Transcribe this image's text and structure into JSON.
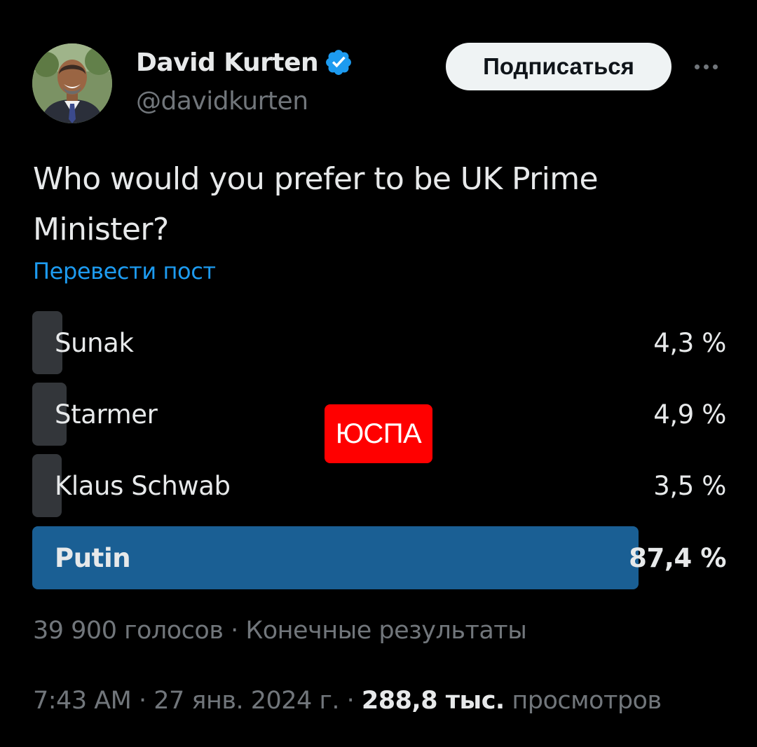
{
  "author": {
    "name": "David Kurten",
    "handle": "@davidkurten",
    "verified_color": "#1d9bf0"
  },
  "follow_button": {
    "label": "Подписаться"
  },
  "more_menu": {
    "icon": "more-horizontal-icon"
  },
  "post": {
    "text": "Who would you prefer to be UK Prime Minister?",
    "translate_label": "Перевести пост"
  },
  "poll": {
    "options": [
      {
        "label": "Sunak",
        "percent_text": "4,3 %",
        "percent": 4.3,
        "winner": false
      },
      {
        "label": "Starmer",
        "percent_text": "4,9 %",
        "percent": 4.9,
        "winner": false
      },
      {
        "label": "Klaus Schwab",
        "percent_text": "3,5 %",
        "percent": 3.5,
        "winner": false
      },
      {
        "label": "Putin",
        "percent_text": "87,4 %",
        "percent": 87.4,
        "winner": true
      }
    ],
    "votes": "39 900 голосов",
    "separator": " · ",
    "status": "Конечные результаты",
    "bar_color": "#33363a",
    "winner_color": "#1a5f94"
  },
  "watermark": {
    "text": "ЮСПА",
    "color": "#ff0000"
  },
  "meta": {
    "time": "7:43 AM",
    "date": "27 янв. 2024 г.",
    "views_count": "288,8 тыс.",
    "views_label": "просмотров",
    "separator": " · "
  }
}
